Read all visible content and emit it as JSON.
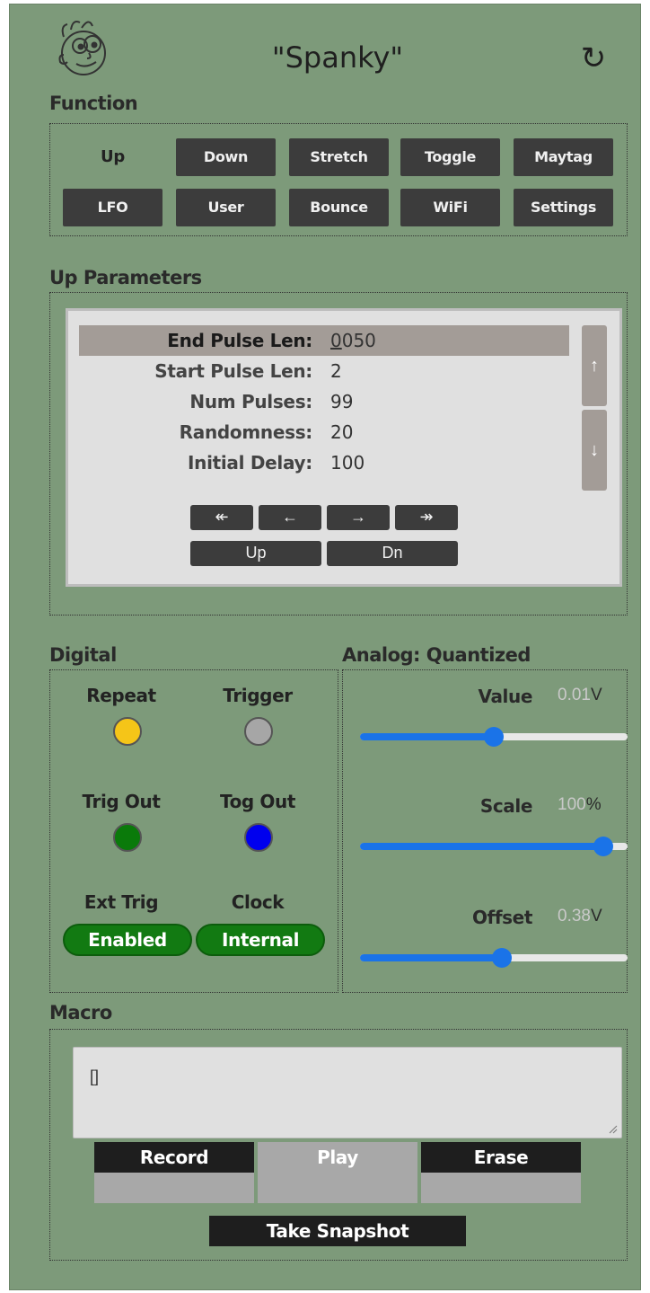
{
  "header": {
    "title": "\"Spanky\"",
    "refresh_icon": "↻"
  },
  "function": {
    "label": "Function",
    "buttons_row1": [
      "Up",
      "Down",
      "Stretch",
      "Toggle",
      "Maytag"
    ],
    "buttons_row2": [
      "LFO",
      "User",
      "Bounce",
      "WiFi",
      "Settings"
    ],
    "active": "Up"
  },
  "params": {
    "label": "Up Parameters",
    "rows": [
      {
        "name": "End Pulse Len:",
        "value_cursor": "0",
        "value_rest": "050",
        "selected": true
      },
      {
        "name": "Start Pulse Len:",
        "value": "2"
      },
      {
        "name": "Num Pulses:",
        "value": "99"
      },
      {
        "name": "Randomness:",
        "value": "20"
      },
      {
        "name": "Initial Delay:",
        "value": "100"
      }
    ],
    "scroll_up": "↑",
    "scroll_down": "↓",
    "nav": [
      "↞",
      "←",
      "→",
      "↠"
    ],
    "up_label": "Up",
    "dn_label": "Dn"
  },
  "digital": {
    "label": "Digital",
    "repeat": "Repeat",
    "trigger": "Trigger",
    "trig_out": "Trig Out",
    "tog_out": "Tog Out",
    "ext_trig": "Ext Trig",
    "clock": "Clock",
    "ext_trig_value": "Enabled",
    "clock_value": "Internal",
    "colors": {
      "repeat": "#f5c518",
      "trigger": "#a6a6a6",
      "trig_out": "#0a7a0a",
      "tog_out": "#0000ee"
    }
  },
  "analog": {
    "label": "Analog: Quantized",
    "value_label": "Value",
    "value_num": "0.01",
    "value_unit": "V",
    "value_level": 0.5,
    "scale_label": "Scale",
    "scale_num": "100",
    "scale_unit": "%",
    "scale_level": 0.91,
    "offset_label": "Offset",
    "offset_num": "0.38",
    "offset_unit": "V",
    "offset_level": 0.53
  },
  "macro": {
    "label": "Macro",
    "text": "[]",
    "record": "Record",
    "play": "Play",
    "erase": "Erase",
    "snapshot": "Take Snapshot"
  }
}
